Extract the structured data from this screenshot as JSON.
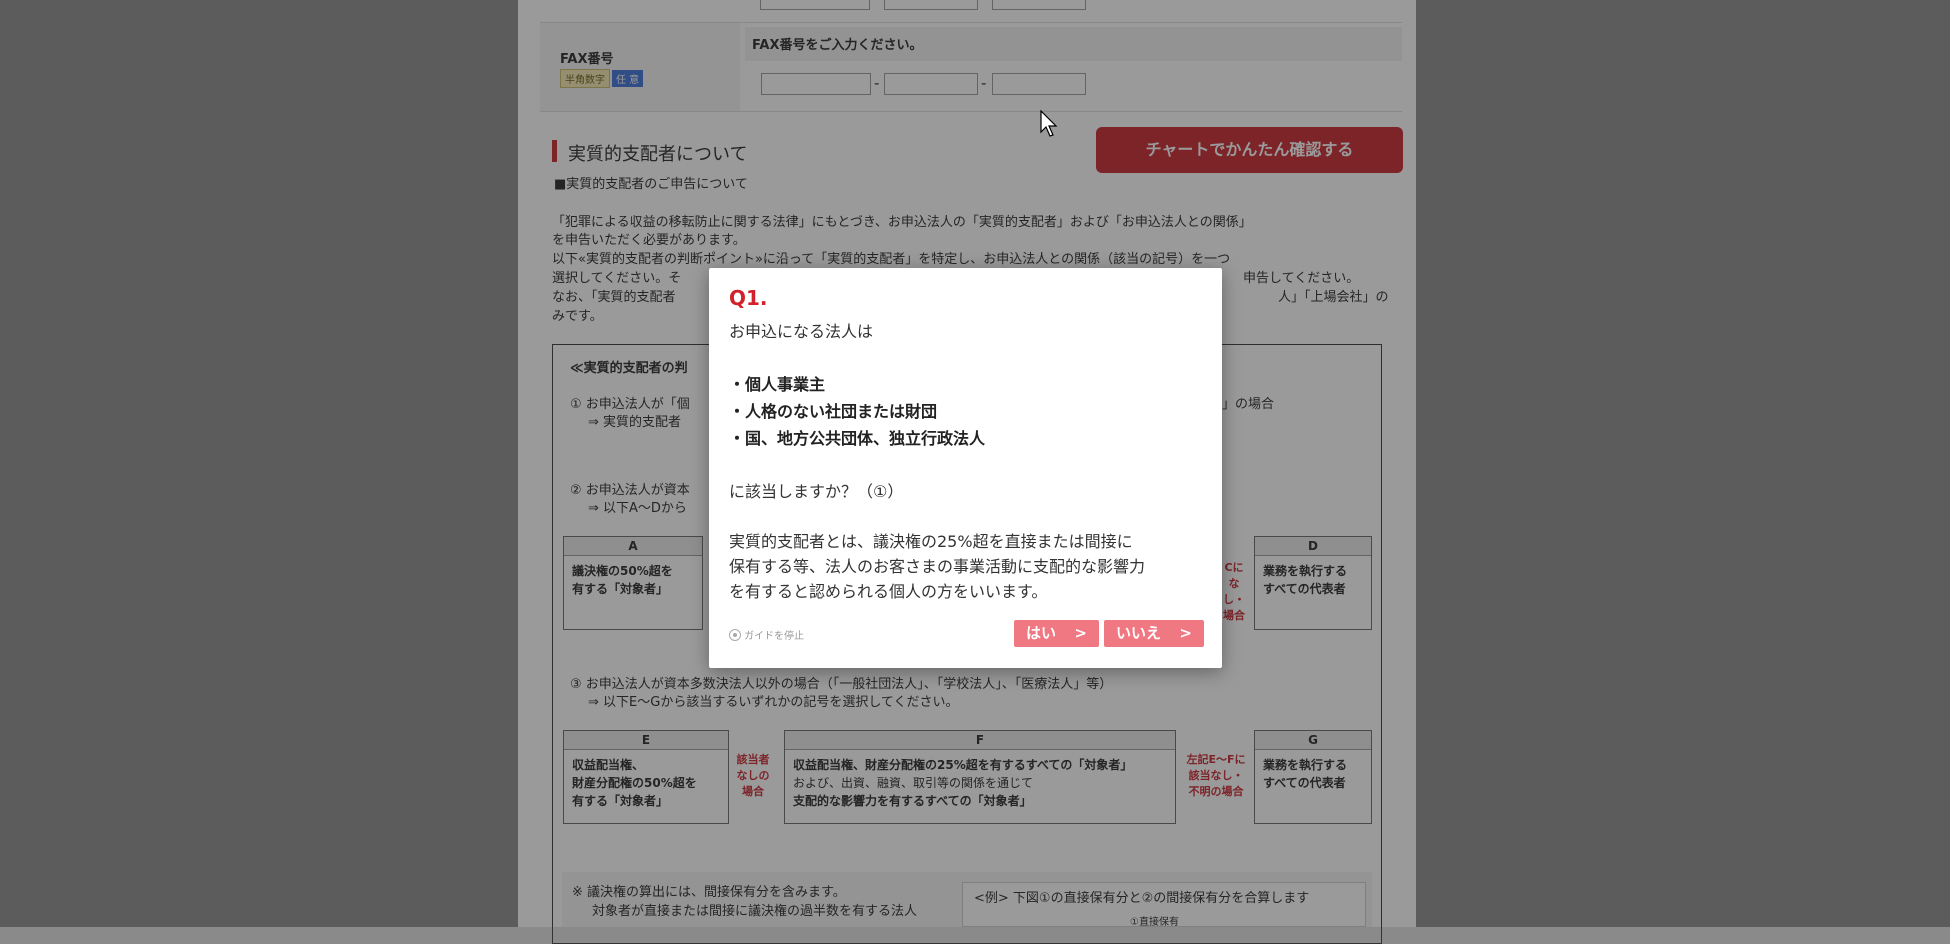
{
  "fax": {
    "label": "FAX番号",
    "tag_half": "半角数字",
    "tag_optional": "任 意",
    "prompt": "FAX番号をご入力ください。",
    "separator": "-"
  },
  "section": {
    "title": "実質的支配者について",
    "chart_button": "チャートでかんたん確認する",
    "subheading": "■実質的支配者のご申告について"
  },
  "intro": {
    "line1": "「犯罪による収益の移転防止に関する法律」にもとづき、お申込法人の「実質的支配者」および「お申込法人との関係」",
    "line2": "を申告いただく必要があります。",
    "line3": "以下«実質的支配者の判断ポイント»に沿って「実質的支配者」を特定し、お申込法人との関係（該当の記号）を一つ",
    "line4": "選択してください。そ",
    "line4_right": "申告してください。",
    "line5": "なお、「実質的支配者",
    "line5_right": "人」「上場会社」の",
    "line6": "みです。"
  },
  "guide": {
    "heading": "≪実質的支配者の判",
    "item1": "① お申込法人が「個",
    "item1_right": "」の場合",
    "item1_sub": "⇒ 実質的支配者",
    "item2": "② お申込法人が資本",
    "item2_sub": "⇒ 以下A～Dから",
    "box_a_head": "A",
    "box_a_line1": "議決権の50%超を",
    "box_a_line2": "有する「対象者」",
    "side_c_line1": "Cに",
    "side_c_line2": "なし・",
    "side_c_line3": "場合",
    "box_d_head": "D",
    "box_d_line1": "業務を執行する",
    "box_d_line2": "すべての代表者",
    "item3": "③ お申込法人が資本多数決法人以外の場合（「一般社団法人」、「学校法人」、「医療法人」等）",
    "item3_sub": "⇒ 以下E～Gから該当するいずれかの記号を選択してください。",
    "box_e_head": "E",
    "box_e_line1": "収益配当権、",
    "box_e_line2": "財産分配権の50%超を",
    "box_e_line3": "有する「対象者」",
    "side_ef_line1": "該当者",
    "side_ef_line2": "なしの",
    "side_ef_line3": "場合",
    "box_f_head": "F",
    "box_f_line1": "収益配当権、財産分配権の25%超を有するすべての「対象者」",
    "box_f_line2": "および、出資、融資、取引等の関係を通じて",
    "box_f_line3": "支配的な影響力を有するすべての「対象者」",
    "side_fg_line1": "左記E～Fに",
    "side_fg_line2": "該当なし・",
    "side_fg_line3": "不明の場合",
    "box_g_head": "G",
    "box_g_line1": "業務を執行する",
    "box_g_line2": "すべての代表者",
    "note1": "※ 議決権の算出には、間接保有分を含みます。",
    "note2": "対象者が直接または間接に議決権の過半数を有する法人",
    "example": "<例> 下図①の直接保有分と②の間接保有分を合算します",
    "example_sub": "①直接保有"
  },
  "modal": {
    "question_no": "Q1.",
    "lead": "お申込になる法人は",
    "option1": "・個人事業主",
    "option2": "・人格のない社団または財団",
    "option3": "・国、地方公共団体、独立行政法人",
    "ask": "に該当しますか？（①）",
    "para_line1": "実質的支配者とは、議決権の25%超を直接または間接に",
    "para_line2": "保有する等、法人のお客さまの事業活動に支配的な影響力",
    "para_line3": "を有すると認められる個人の方をいいます。",
    "guide_stop": "ガイドを停止",
    "yes": "はい",
    "no": "いいえ",
    "chevron": ">"
  },
  "colors": {
    "accent_red": "#c8202b",
    "modal_button": "#f07882"
  }
}
